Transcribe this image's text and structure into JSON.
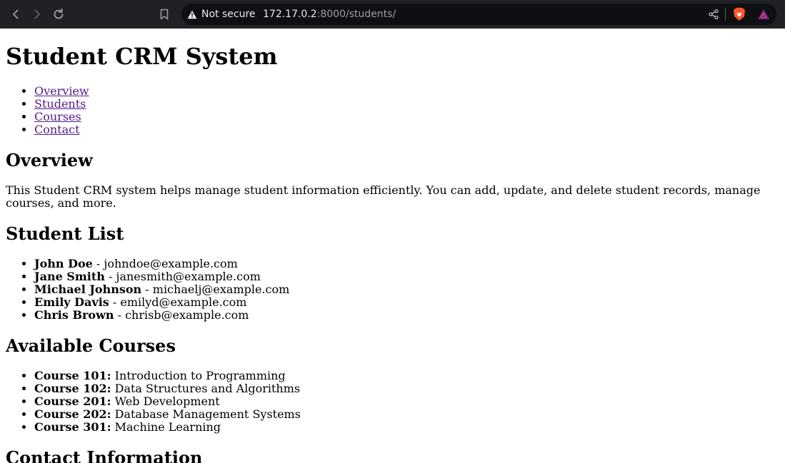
{
  "browser": {
    "security_label": "Not secure",
    "url_host": "172.17.0.2",
    "url_rest": ":8000/students/"
  },
  "page": {
    "title": "Student CRM System",
    "nav": [
      {
        "label": "Overview"
      },
      {
        "label": "Students"
      },
      {
        "label": "Courses"
      },
      {
        "label": "Contact"
      }
    ],
    "overview": {
      "heading": "Overview",
      "text": "This Student CRM system helps manage student information efficiently. You can add, update, and delete student records, manage courses, and more."
    },
    "students": {
      "heading": "Student List",
      "separator": " - ",
      "items": [
        {
          "name": "John Doe",
          "email": "johndoe@example.com"
        },
        {
          "name": "Jane Smith",
          "email": "janesmith@example.com"
        },
        {
          "name": "Michael Johnson",
          "email": "michaelj@example.com"
        },
        {
          "name": "Emily Davis",
          "email": "emilyd@example.com"
        },
        {
          "name": "Chris Brown",
          "email": "chrisb@example.com"
        }
      ]
    },
    "courses": {
      "heading": "Available Courses",
      "items": [
        {
          "code": "Course 101:",
          "title": "Introduction to Programming"
        },
        {
          "code": "Course 102:",
          "title": "Data Structures and Algorithms"
        },
        {
          "code": "Course 201:",
          "title": "Web Development"
        },
        {
          "code": "Course 202:",
          "title": "Database Management Systems"
        },
        {
          "code": "Course 301:",
          "title": "Machine Learning"
        }
      ]
    },
    "contact": {
      "heading": "Contact Information"
    }
  },
  "colors": {
    "link": "#0000ee",
    "visited_link": "#551a8b",
    "chrome_bg": "#202124"
  }
}
